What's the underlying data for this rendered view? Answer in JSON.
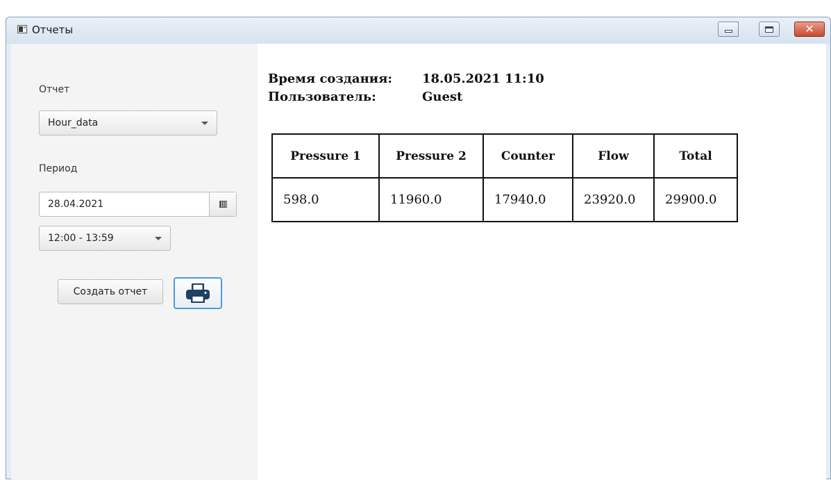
{
  "window": {
    "title": "Отчеты",
    "controls": {
      "minimize": "minimize",
      "maximize": "maximize",
      "close": "close"
    }
  },
  "sidebar": {
    "report_label": "Отчет",
    "report_select_value": "Hour_data",
    "period_label": "Период",
    "date_value": "28.04.2021",
    "time_select_value": "12:00 - 13:59",
    "create_button_label": "Создать отчет",
    "print_icon": "printer-icon"
  },
  "report": {
    "created_label": "Время создания:",
    "created_value": "18.05.2021 11:10",
    "user_label": "Пользователь:",
    "user_value": "Guest",
    "table": {
      "columns": [
        "Pressure 1",
        "Pressure 2",
        "Counter",
        "Flow",
        "Total"
      ],
      "rows": [
        [
          "598.0",
          "11960.0",
          "17940.0",
          "23920.0",
          "29900.0"
        ]
      ]
    }
  },
  "colors": {
    "sidebar_bg": "#f4f4f4",
    "focus_border": "#4a9be0",
    "print_icon": "#1f3f66",
    "close_button": "#c64a31"
  }
}
